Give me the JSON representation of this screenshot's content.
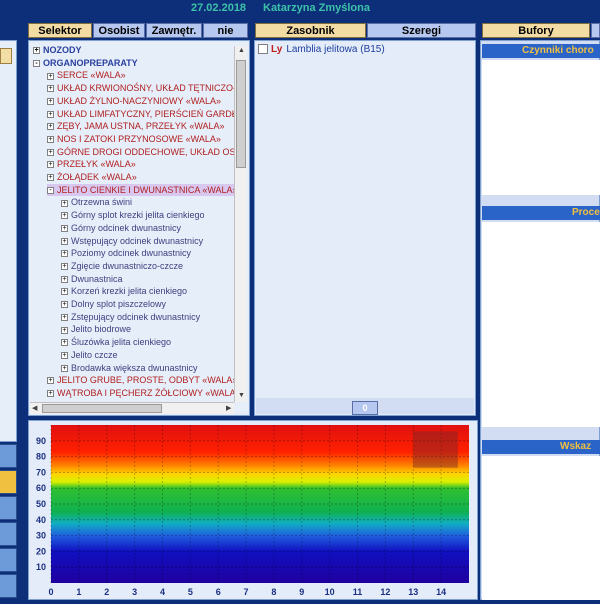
{
  "header": {
    "date": "27.02.2018",
    "patient": "Katarzyna Zmyślona"
  },
  "tabs_left": [
    "Selektor",
    "Osobist",
    "Zawnętr.",
    "nie"
  ],
  "tabs_mid": [
    "Zasobnik",
    "Szeregi"
  ],
  "tabs_right": [
    "Bufory"
  ],
  "tree": [
    {
      "label": "NOZODY",
      "level": 0,
      "expander": "+"
    },
    {
      "label": "ORGANOPREPARATY",
      "level": 0,
      "expander": "-"
    },
    {
      "label": "SERCE «WALA»",
      "level": 1,
      "expander": "+"
    },
    {
      "label": "UKŁAD KRWIONOŚNY, UKŁAD TĘTNICZO-",
      "level": 1,
      "expander": "+"
    },
    {
      "label": "UKŁAD ŻYLNO-NACZYNIOWY «WALA»",
      "level": 1,
      "expander": "+"
    },
    {
      "label": "UKŁAD LIMFATYCZNY, PIERŚCIEŃ GARDŁ",
      "level": 1,
      "expander": "+"
    },
    {
      "label": "ZĘBY, JAMA USTNA, PRZEŁYK «WALA»",
      "level": 1,
      "expander": "+"
    },
    {
      "label": "NOS I ZATOKI PRZYNOSOWE «WALA»",
      "level": 1,
      "expander": "+"
    },
    {
      "label": "GÓRNE DROGI ODDECHOWE, UKŁAD OSK",
      "level": 1,
      "expander": "+"
    },
    {
      "label": "PRZEŁYK «WALA»",
      "level": 1,
      "expander": "+"
    },
    {
      "label": "ŻOŁĄDEK «WALA»",
      "level": 1,
      "expander": "+"
    },
    {
      "label": "JELITO CIENKIE I DWUNASTNICA «WALA»",
      "level": 1,
      "expander": "-",
      "selected": true
    },
    {
      "label": "Otrzewna świni",
      "level": 2,
      "expander": "+"
    },
    {
      "label": "Górny splot krezki jelita cienkiego",
      "level": 2,
      "expander": "+"
    },
    {
      "label": "Górny odcinek dwunastnicy",
      "level": 2,
      "expander": "+"
    },
    {
      "label": "Wstępujący odcinek dwunastnicy",
      "level": 2,
      "expander": "+"
    },
    {
      "label": "Poziomy odcinek dwunastnicy",
      "level": 2,
      "expander": "+"
    },
    {
      "label": "Zgięcie dwunastniczo-czcze",
      "level": 2,
      "expander": "+"
    },
    {
      "label": "Dwunastnica",
      "level": 2,
      "expander": "+"
    },
    {
      "label": "Korzeń krezki jelita cienkiego",
      "level": 2,
      "expander": "+"
    },
    {
      "label": "Dolny splot piszczelowy",
      "level": 2,
      "expander": "+"
    },
    {
      "label": "Zstępujący odcinek dwunastnicy",
      "level": 2,
      "expander": "+"
    },
    {
      "label": "Jelito biodrowe",
      "level": 2,
      "expander": "+"
    },
    {
      "label": "Śluzówka jelita cienkiego",
      "level": 2,
      "expander": "+"
    },
    {
      "label": "Jelito czcze",
      "level": 2,
      "expander": "+"
    },
    {
      "label": "Brodawka większa dwunastnicy",
      "level": 2,
      "expander": "+"
    },
    {
      "label": "JELITO GRUBE, PROSTE, ODBYT «WALA»",
      "level": 1,
      "expander": "+"
    },
    {
      "label": "WĄTROBA I PĘCHERZ ŻÓŁCIOWY «WALA",
      "level": 1,
      "expander": "+"
    }
  ],
  "zasobnik_item": {
    "code": "Ly",
    "name": "Lamblia jelitowa (B15)"
  },
  "zasobnik_count": "0",
  "right_sections": [
    "Czynniki choro",
    "Proce",
    "Wskaz"
  ],
  "chart_data": {
    "type": "heatmap",
    "x_ticks": [
      0,
      1,
      2,
      3,
      4,
      5,
      6,
      7,
      8,
      9,
      10,
      11,
      12,
      13,
      14
    ],
    "y_ticks": [
      10,
      20,
      30,
      40,
      50,
      60,
      70,
      80,
      90
    ],
    "xlim": [
      0,
      15
    ],
    "ylim": [
      0,
      100
    ],
    "highlight": {
      "x": [
        13,
        14.6
      ],
      "y": [
        73,
        96
      ]
    }
  }
}
